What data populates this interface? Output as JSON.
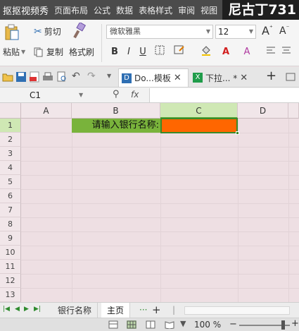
{
  "overlay": {
    "recorder_label": "抠抠视频秀",
    "brand_text": "尼古丁731"
  },
  "menu": {
    "items": [
      "页面布局",
      "公式",
      "数据",
      "表格样式",
      "审阅",
      "视图"
    ]
  },
  "ribbon": {
    "paste_label": "粘贴",
    "cut_label": "剪切",
    "copy_label": "复制",
    "format_painter_label": "格式刷",
    "font_name": "微软雅黑",
    "font_size": "12",
    "bold_label": "B",
    "italic_label": "I",
    "underline_label": "U",
    "grow_font_label": "A",
    "shrink_font_label": "A"
  },
  "doc_tabs": [
    {
      "label": "Do...模板",
      "active": true
    },
    {
      "label": "下拉... *",
      "active": false
    }
  ],
  "formula_bar": {
    "name_box": "C1",
    "fx_label": "fx",
    "formula_value": ""
  },
  "columns": [
    "A",
    "B",
    "C",
    "D"
  ],
  "rows": [
    "1",
    "2",
    "3",
    "4",
    "5",
    "6",
    "7",
    "8",
    "9",
    "10",
    "11",
    "12",
    "13",
    "14"
  ],
  "cells": {
    "B1": "请输入银行名称:",
    "C1": ""
  },
  "colors": {
    "label_cell_fill": "#79b33b",
    "input_cell_fill": "#ff6600",
    "selection_border": "#3a8a2a"
  },
  "sheets": [
    {
      "label": "银行名称",
      "active": false
    },
    {
      "label": "主页",
      "active": true
    }
  ],
  "sheet_bar": {
    "more_label": "···",
    "add_label": "+"
  },
  "status": {
    "zoom_label": "100 %",
    "zoom_minus": "−",
    "zoom_plus": "+",
    "zoom_level": 1.0
  }
}
